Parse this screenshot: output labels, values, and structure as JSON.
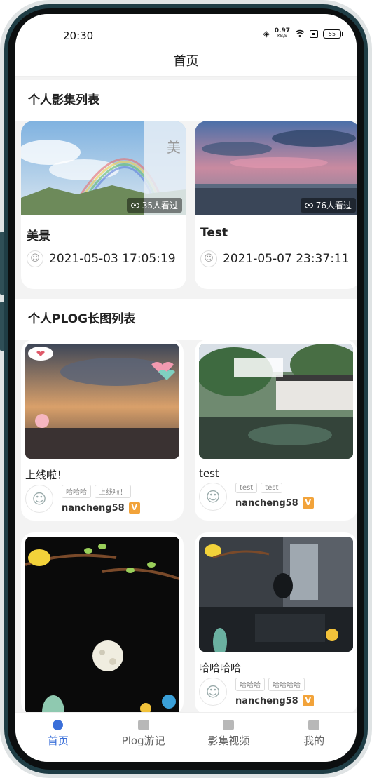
{
  "status": {
    "time": "20:30",
    "speed_value": "0.97",
    "speed_unit": "KB/S",
    "battery": "55"
  },
  "navbar": {
    "title": "首页"
  },
  "albums_section": {
    "title": "个人影集列表"
  },
  "albums": [
    {
      "title": "美景",
      "views": "35人看过",
      "date": "2021-05-03 17:05:19",
      "overlay_text": "美"
    },
    {
      "title": "Test",
      "views": "76人看过",
      "date": "2021-05-07 23:37:11"
    }
  ],
  "plog_section": {
    "title": "个人PLOG长图列表"
  },
  "plogs": [
    {
      "title": "上线啦！",
      "tags": [
        "哈哈哈",
        "上线啦！"
      ],
      "author": "nancheng58",
      "vip": "V"
    },
    {
      "title": "test",
      "tags": [
        "test",
        "test"
      ],
      "author": "nancheng58",
      "vip": "V"
    },
    {
      "title": "",
      "tags": [],
      "author": "",
      "vip": ""
    },
    {
      "title": "哈哈哈哈",
      "tags": [
        "哈哈哈",
        "哈哈哈哈"
      ],
      "author": "nancheng58",
      "vip": "V"
    }
  ],
  "tabbar": {
    "tabs": [
      {
        "label": "首页",
        "icon": "home-icon",
        "active": true
      },
      {
        "label": "Plog游记",
        "icon": "camera-icon",
        "active": false
      },
      {
        "label": "影集视频",
        "icon": "video-icon",
        "active": false
      },
      {
        "label": "我的",
        "icon": "profile-icon",
        "active": false
      }
    ]
  },
  "colors": {
    "accent": "#3a6fd9",
    "vip": "#f2a33a"
  }
}
